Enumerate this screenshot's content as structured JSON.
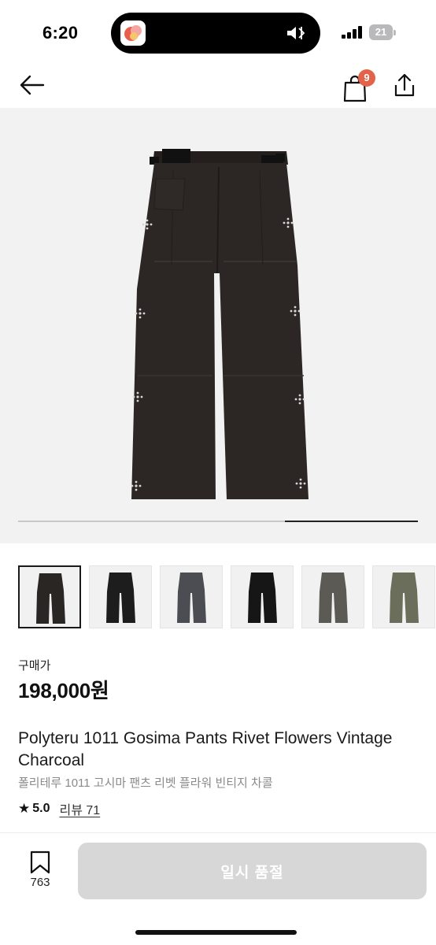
{
  "status_bar": {
    "time": "6:20",
    "battery": "21",
    "icons": [
      "app-icon",
      "silent-mode-icon",
      "signal-icon",
      "battery-icon"
    ]
  },
  "nav": {
    "cart_count": "9",
    "icons": [
      "back-arrow-icon",
      "shopping-bag-icon",
      "share-icon"
    ]
  },
  "gallery": {
    "progress": 0.333,
    "thumbnails": [
      {
        "color": "#2a2624",
        "selected": true
      },
      {
        "color": "#1d1d1d",
        "selected": false
      },
      {
        "color": "#4b4d52",
        "selected": false
      },
      {
        "color": "#161616",
        "selected": false
      },
      {
        "color": "#5b5a55",
        "selected": false
      },
      {
        "color": "#6b6e5a",
        "selected": false
      }
    ]
  },
  "product": {
    "price_label": "구매가",
    "price": "198,000원",
    "title_en": "Polyteru 1011 Gosima Pants Rivet Flowers Vintage Charcoal",
    "title_ko": "폴리테루 1011 고시마 팬츠 리벳 플라워 빈티지 차콜",
    "rating_star": "★",
    "rating": "5.0",
    "reviews": "리뷰 71"
  },
  "actions": {
    "wish_count": "763",
    "buy_label": "일시 품절",
    "icons": [
      "bookmark-icon"
    ]
  },
  "colors": {
    "badge": "#e2624a",
    "button_disabled": "#d7d7d7",
    "pants_main": "#2a2624"
  }
}
